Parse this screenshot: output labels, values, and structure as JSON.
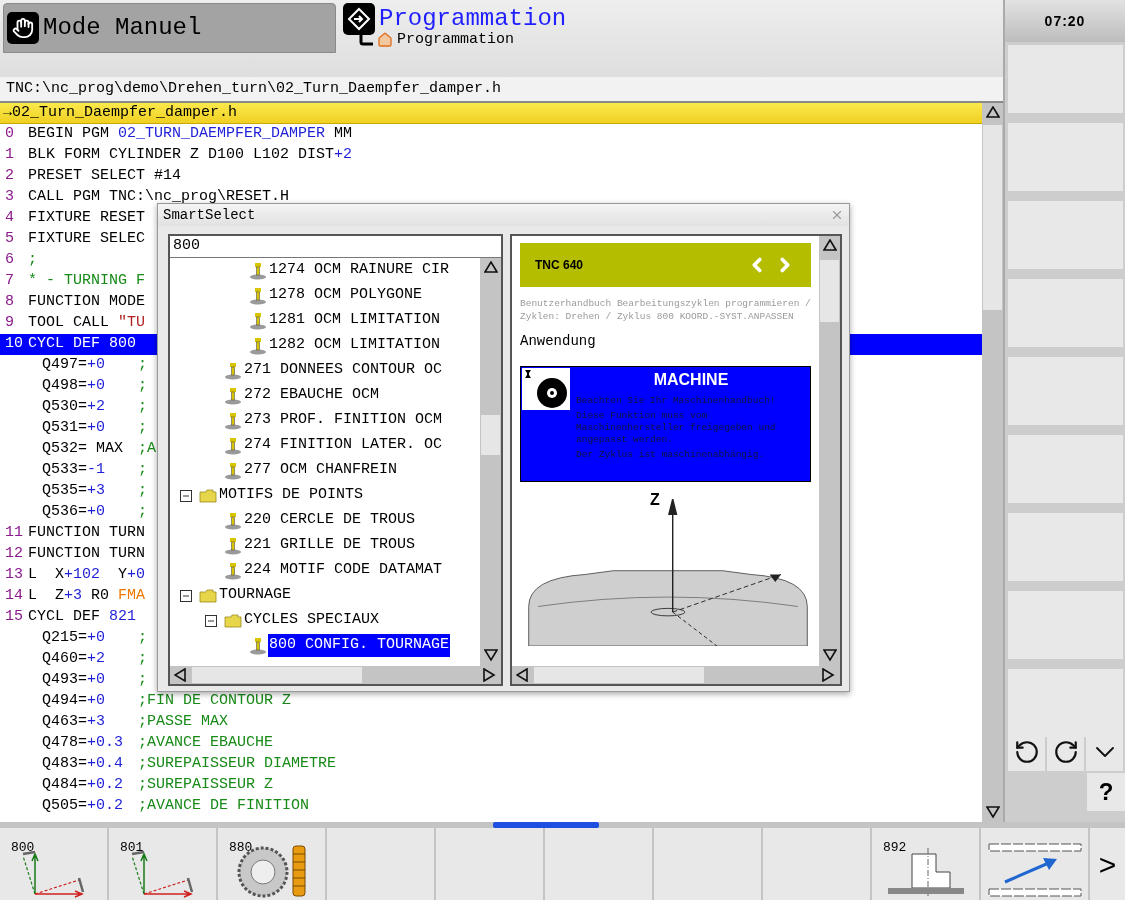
{
  "header": {
    "modes": [
      {
        "label": "Mode Manuel",
        "kind": "manual",
        "selected": false
      },
      {
        "label": "Programmation",
        "subtitle": "Programmation",
        "kind": "programming",
        "selected": true
      }
    ],
    "clock": "07:20"
  },
  "editor": {
    "path": "TNC:\\nc_prog\\demo\\Drehen_turn\\02_Turn_Daempfer_damper.h",
    "file_tab": "→02_Turn_Daempfer_damper.h",
    "lines": [
      {
        "kind": "statement",
        "no": "0",
        "selected": false,
        "segments": [
          {
            "text": "BEGIN PGM ",
            "kind": "plain"
          },
          {
            "text": "02_TURN_DAEMPFER_DAMPER",
            "kind": "num"
          },
          {
            "text": " MM",
            "kind": "plain"
          }
        ]
      },
      {
        "kind": "statement",
        "no": "1",
        "selected": false,
        "segments": [
          {
            "text": "BLK FORM CYLINDER Z D100 L102 DIST",
            "kind": "plain"
          },
          {
            "text": "+2",
            "kind": "num"
          }
        ]
      },
      {
        "kind": "statement",
        "no": "2",
        "selected": false,
        "segments": [
          {
            "text": "PRESET SELECT #14",
            "kind": "plain"
          }
        ]
      },
      {
        "kind": "statement",
        "no": "3",
        "selected": false,
        "segments": [
          {
            "text": "CALL PGM TNC:\\nc_prog\\RESET.H",
            "kind": "plain"
          }
        ]
      },
      {
        "kind": "statement",
        "no": "4",
        "selected": false,
        "segments": [
          {
            "text": "FIXTURE RESET",
            "kind": "plain"
          }
        ]
      },
      {
        "kind": "statement",
        "no": "5",
        "selected": false,
        "segments": [
          {
            "text": "FIXTURE SELEC",
            "kind": "plain"
          }
        ]
      },
      {
        "kind": "statement",
        "no": "6",
        "selected": false,
        "segments": [
          {
            "text": ";",
            "kind": "comment"
          }
        ]
      },
      {
        "kind": "statement",
        "no": "7",
        "selected": false,
        "segments": [
          {
            "text": "* - TURNING F",
            "kind": "comment"
          }
        ]
      },
      {
        "kind": "statement",
        "no": "8",
        "selected": false,
        "segments": [
          {
            "text": "FUNCTION MODE",
            "kind": "plain"
          }
        ]
      },
      {
        "kind": "statement",
        "no": "9",
        "selected": false,
        "segments": [
          {
            "text": "TOOL CALL ",
            "kind": "plain"
          },
          {
            "text": "\"TU",
            "kind": "str"
          }
        ]
      },
      {
        "kind": "statement",
        "no": "10",
        "selected": true,
        "segments": [
          {
            "text": "CYCL DEF 800",
            "kind": "plain"
          }
        ]
      },
      {
        "kind": "param",
        "selected": false,
        "segments": [
          {
            "text": "Q497=",
            "kind": "plain"
          },
          {
            "text": "+0",
            "kind": "num"
          }
        ],
        "comment": ";"
      },
      {
        "kind": "param",
        "selected": false,
        "segments": [
          {
            "text": "Q498=",
            "kind": "plain"
          },
          {
            "text": "+0",
            "kind": "num"
          }
        ],
        "comment": ";"
      },
      {
        "kind": "param",
        "selected": false,
        "segments": [
          {
            "text": "Q530=",
            "kind": "plain"
          },
          {
            "text": "+2",
            "kind": "num"
          }
        ],
        "comment": ";"
      },
      {
        "kind": "param",
        "selected": false,
        "segments": [
          {
            "text": "Q531=",
            "kind": "plain"
          },
          {
            "text": "+0",
            "kind": "num"
          }
        ],
        "comment": ";"
      },
      {
        "kind": "param",
        "selected": false,
        "segments": [
          {
            "text": "Q532= MAX",
            "kind": "plain"
          }
        ],
        "comment": ";A"
      },
      {
        "kind": "param",
        "selected": false,
        "segments": [
          {
            "text": "Q533=",
            "kind": "plain"
          },
          {
            "text": "-1",
            "kind": "num"
          }
        ],
        "comment": ";"
      },
      {
        "kind": "param",
        "selected": false,
        "segments": [
          {
            "text": "Q535=",
            "kind": "plain"
          },
          {
            "text": "+3",
            "kind": "num"
          }
        ],
        "comment": ";"
      },
      {
        "kind": "param",
        "selected": false,
        "segments": [
          {
            "text": "Q536=",
            "kind": "plain"
          },
          {
            "text": "+0",
            "kind": "num"
          }
        ],
        "comment": ";"
      },
      {
        "kind": "statement",
        "no": "11",
        "selected": false,
        "segments": [
          {
            "text": "FUNCTION TURN",
            "kind": "plain"
          }
        ]
      },
      {
        "kind": "statement",
        "no": "12",
        "selected": false,
        "segments": [
          {
            "text": "FUNCTION TURN",
            "kind": "plain"
          }
        ]
      },
      {
        "kind": "statement",
        "no": "13",
        "selected": false,
        "segments": [
          {
            "text": "L  X",
            "kind": "plain"
          },
          {
            "text": "+102",
            "kind": "num"
          },
          {
            "text": "  Y",
            "kind": "plain"
          },
          {
            "text": "+0",
            "kind": "num"
          }
        ]
      },
      {
        "kind": "statement",
        "no": "14",
        "selected": false,
        "segments": [
          {
            "text": "L  Z",
            "kind": "plain"
          },
          {
            "text": "+3",
            "kind": "num"
          },
          {
            "text": " R0 ",
            "kind": "plain"
          },
          {
            "text": "FMA",
            "kind": "feed"
          }
        ]
      },
      {
        "kind": "statement",
        "no": "15",
        "selected": false,
        "segments": [
          {
            "text": "CYCL DEF ",
            "kind": "plain"
          },
          {
            "text": "821",
            "kind": "num"
          }
        ]
      },
      {
        "kind": "param",
        "selected": false,
        "segments": [
          {
            "text": "Q215=",
            "kind": "plain"
          },
          {
            "text": "+0",
            "kind": "num"
          }
        ],
        "comment": ";"
      },
      {
        "kind": "param",
        "selected": false,
        "segments": [
          {
            "text": "Q460=",
            "kind": "plain"
          },
          {
            "text": "+2",
            "kind": "num"
          }
        ],
        "comment": ";"
      },
      {
        "kind": "param",
        "selected": false,
        "segments": [
          {
            "text": "Q493=",
            "kind": "plain"
          },
          {
            "text": "+0",
            "kind": "num"
          }
        ],
        "comment": ";"
      },
      {
        "kind": "param",
        "selected": false,
        "segments": [
          {
            "text": "Q494=",
            "kind": "plain"
          },
          {
            "text": "+0",
            "kind": "num"
          }
        ],
        "comment": ";FIN DE CONTOUR Z"
      },
      {
        "kind": "param",
        "selected": false,
        "segments": [
          {
            "text": "Q463=",
            "kind": "plain"
          },
          {
            "text": "+3",
            "kind": "num"
          }
        ],
        "comment": ";PASSE MAX"
      },
      {
        "kind": "param",
        "selected": false,
        "segments": [
          {
            "text": "Q478=",
            "kind": "plain"
          },
          {
            "text": "+0.3",
            "kind": "num"
          }
        ],
        "comment": ";AVANCE EBAUCHE"
      },
      {
        "kind": "param",
        "selected": false,
        "segments": [
          {
            "text": "Q483=",
            "kind": "plain"
          },
          {
            "text": "+0.4",
            "kind": "num"
          }
        ],
        "comment": ";SUREPAISSEUR DIAMETRE"
      },
      {
        "kind": "param",
        "selected": false,
        "segments": [
          {
            "text": "Q484=",
            "kind": "plain"
          },
          {
            "text": "+0.2",
            "kind": "num"
          }
        ],
        "comment": ";SUREPAISSEUR Z"
      },
      {
        "kind": "param",
        "selected": false,
        "segments": [
          {
            "text": "Q505=",
            "kind": "plain"
          },
          {
            "text": "+0.2",
            "kind": "num"
          }
        ],
        "comment": ";AVANCE DE FINITION"
      }
    ]
  },
  "dialog": {
    "title": "SmartSelect",
    "search": "800",
    "tree": [
      {
        "children": [
          {
            "children": [
              {
                "label": "1274 OCM RAINURE CIR",
                "kind": "cycle",
                "selected": false
              },
              {
                "label": "1278 OCM POLYGONE",
                "kind": "cycle",
                "selected": false
              },
              {
                "label": "1281 OCM LIMITATION",
                "kind": "cycle",
                "selected": false
              },
              {
                "label": "1282 OCM LIMITATION",
                "kind": "cycle",
                "selected": false
              }
            ]
          },
          {
            "label": "271 DONNEES CONTOUR OC",
            "kind": "cycle",
            "selected": false
          },
          {
            "label": "272 EBAUCHE OCM",
            "kind": "cycle",
            "selected": false
          },
          {
            "label": "273 PROF. FINITION OCM",
            "kind": "cycle",
            "selected": false
          },
          {
            "label": "274 FINITION LATER. OC",
            "kind": "cycle",
            "selected": false
          },
          {
            "label": "277 OCM CHANFREIN",
            "kind": "cycle",
            "selected": false
          }
        ]
      },
      {
        "label": "MOTIFS DE POINTS",
        "kind": "folder",
        "expanded": true,
        "selected": false,
        "children": [
          {
            "label": "220 CERCLE DE TROUS",
            "kind": "cycle",
            "selected": false
          },
          {
            "label": "221 GRILLE DE TROUS",
            "kind": "cycle",
            "selected": false
          },
          {
            "label": "224 MOTIF CODE DATAMAT",
            "kind": "cycle",
            "selected": false
          }
        ]
      },
      {
        "label": "TOURNAGE",
        "kind": "folder",
        "expanded": true,
        "selected": false,
        "children": [
          {
            "label": "CYCLES SPECIAUX",
            "kind": "folder",
            "expanded": true,
            "selected": false,
            "children": [
              {
                "label": "800 CONFIG. TOURNAGE",
                "kind": "cycle",
                "selected": true
              }
            ]
          }
        ]
      }
    ],
    "help": {
      "product": "TNC 640",
      "breadcrumb": "Benutzerhandbuch Bearbeitungszyklen programmieren / Zyklen: Drehen / Zyklus 800 KOORD.-SYST.ANPASSEN",
      "heading": "Anwendung",
      "notice": {
        "title": "MACHINE",
        "paragraphs": [
          "Beachten Sie Ihr Maschinenhandbuch!",
          "Diese Funktion muss vom Maschinenhersteller freigegeben und angepasst werden.",
          "Der Zyklus ist maschinenabhängig."
        ]
      },
      "figure": {
        "axis_label": "Z"
      }
    }
  },
  "side_softkeys": [
    {
      "kind": "empty"
    },
    {
      "kind": "empty"
    },
    {
      "kind": "empty"
    },
    {
      "kind": "empty"
    },
    {
      "kind": "empty"
    },
    {
      "kind": "empty"
    },
    {
      "kind": "empty"
    },
    {
      "kind": "empty"
    },
    {
      "kind": "empty"
    }
  ],
  "side_controls": [
    {
      "kind": "rotate-left"
    },
    {
      "kind": "rotate-right"
    },
    {
      "kind": "down"
    }
  ],
  "help_button": "?",
  "softkeys": [
    {
      "kind": "axes",
      "label": "800"
    },
    {
      "kind": "axes",
      "label": "801"
    },
    {
      "kind": "gear",
      "label": "880"
    },
    {
      "kind": "empty"
    },
    {
      "kind": "empty"
    },
    {
      "kind": "empty"
    },
    {
      "kind": "empty"
    },
    {
      "kind": "empty"
    },
    {
      "kind": "contour",
      "label": "892"
    },
    {
      "kind": "transfer"
    }
  ],
  "next_key": ">"
}
